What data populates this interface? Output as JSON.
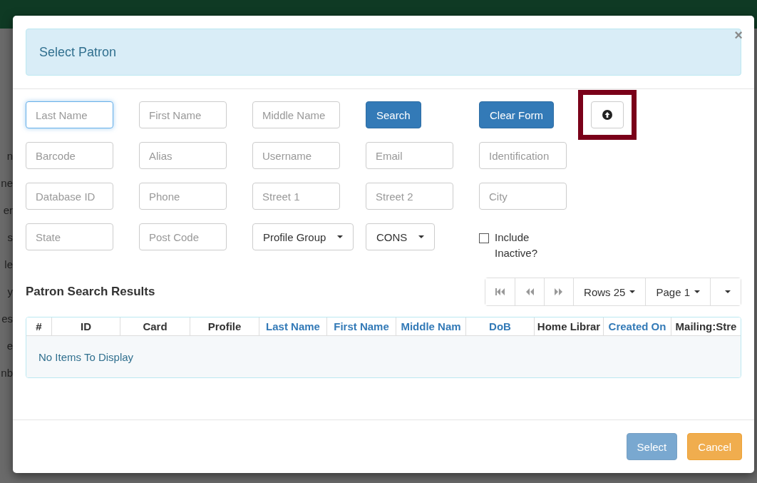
{
  "backdrop": {
    "fragments": [
      "n",
      "ne",
      "er",
      "s",
      "le",
      "y",
      "es",
      "e",
      "nb"
    ]
  },
  "modal": {
    "title": "Select Patron",
    "close": "×",
    "form": [
      {
        "kind": "input",
        "placeholder": "Last Name",
        "focused": true
      },
      {
        "kind": "input",
        "placeholder": "First Name",
        "focused": false
      },
      {
        "kind": "input",
        "placeholder": "Middle Name",
        "focused": false
      },
      {
        "kind": "button",
        "label": "Search"
      },
      {
        "kind": "button",
        "label": "Clear Form"
      },
      {
        "kind": "icon-button",
        "highlighted": true
      },
      {
        "kind": "input",
        "placeholder": "Barcode",
        "focused": false
      },
      {
        "kind": "input",
        "placeholder": "Alias",
        "focused": false
      },
      {
        "kind": "input",
        "placeholder": "Username",
        "focused": false
      },
      {
        "kind": "input",
        "placeholder": "Email",
        "focused": false
      },
      {
        "kind": "input",
        "placeholder": "Identification",
        "focused": false
      },
      {
        "kind": "blank"
      },
      {
        "kind": "input",
        "placeholder": "Database ID",
        "focused": false
      },
      {
        "kind": "input",
        "placeholder": "Phone",
        "focused": false
      },
      {
        "kind": "input",
        "placeholder": "Street 1",
        "focused": false
      },
      {
        "kind": "input",
        "placeholder": "Street 2",
        "focused": false
      },
      {
        "kind": "input",
        "placeholder": "City",
        "focused": false
      },
      {
        "kind": "blank"
      },
      {
        "kind": "input",
        "placeholder": "State",
        "focused": false
      },
      {
        "kind": "input",
        "placeholder": "Post Code",
        "focused": false
      },
      {
        "kind": "dropdown",
        "label": "Profile Group"
      },
      {
        "kind": "dropdown",
        "label": "CONS"
      },
      {
        "kind": "checkbox",
        "label": "Include Inactive?",
        "checked": false
      }
    ],
    "results": {
      "title": "Patron Search Results",
      "pager": [
        {
          "kind": "first"
        },
        {
          "kind": "prev"
        },
        {
          "kind": "next"
        },
        {
          "kind": "menu",
          "label": "Rows 25"
        },
        {
          "kind": "menu",
          "label": "Page 1"
        },
        {
          "kind": "menu"
        }
      ],
      "columns": [
        {
          "label": "#",
          "sortable": false
        },
        {
          "label": "ID",
          "sortable": false
        },
        {
          "label": "Card",
          "sortable": false
        },
        {
          "label": "Profile",
          "sortable": false
        },
        {
          "label": "Last Name",
          "sortable": true
        },
        {
          "label": "First Name",
          "sortable": true
        },
        {
          "label": "Middle Nam",
          "sortable": true
        },
        {
          "label": "DoB",
          "sortable": true
        },
        {
          "label": "Home Librar",
          "sortable": false
        },
        {
          "label": "Created On",
          "sortable": true
        },
        {
          "label": "Mailing:Stre",
          "sortable": false
        }
      ],
      "empty": "No Items To Display"
    },
    "buttons": [
      {
        "label": "Select",
        "kind": "primary",
        "disabled": true
      },
      {
        "label": "Cancel",
        "kind": "warning",
        "disabled": false
      }
    ]
  }
}
